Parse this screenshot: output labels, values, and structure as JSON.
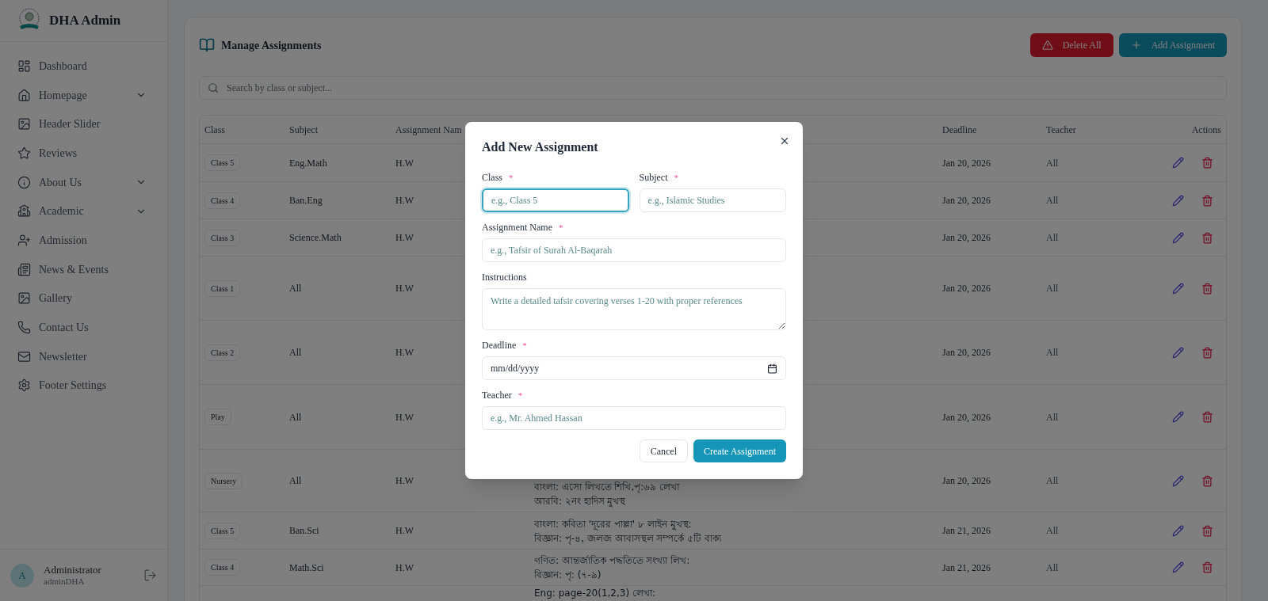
{
  "sidebar": {
    "brand": "DHA Admin",
    "items": [
      {
        "label": "Dashboard",
        "kind": "dashboard",
        "expandable": false
      },
      {
        "label": "Homepage",
        "kind": "home",
        "expandable": true
      },
      {
        "label": "Header Slider",
        "kind": "image",
        "expandable": false
      },
      {
        "label": "Reviews",
        "kind": "star",
        "expandable": false
      },
      {
        "label": "About Us",
        "kind": "info",
        "expandable": true
      },
      {
        "label": "Academic",
        "kind": "school",
        "expandable": true
      },
      {
        "label": "Admission",
        "kind": "user-plus",
        "expandable": false
      },
      {
        "label": "News & Events",
        "kind": "news",
        "expandable": false
      },
      {
        "label": "Gallery",
        "kind": "image",
        "expandable": false
      },
      {
        "label": "Contact Us",
        "kind": "phone",
        "expandable": false
      },
      {
        "label": "Newsletter",
        "kind": "mail",
        "expandable": false
      },
      {
        "label": "Footer Settings",
        "kind": "settings",
        "expandable": false
      }
    ],
    "user": {
      "initial": "A",
      "name": "Administrator",
      "username": "adminDHA"
    }
  },
  "page": {
    "title": "Manage Assignments",
    "buttons": [
      {
        "label": "Delete All",
        "kind": "danger"
      },
      {
        "label": "Add Assignment",
        "kind": "primary"
      }
    ],
    "search": {
      "placeholder": "Search by class or subject..."
    }
  },
  "table": {
    "columns": {
      "class": "Class",
      "subject": "Subject",
      "name": "Assignment Nam",
      "deadline": "Deadline",
      "teacher": "Teacher",
      "actions": "Actions"
    },
    "rows": [
      {
        "class": "Class 5",
        "subject": "Eng.Math",
        "name": "H.W",
        "deadline": "Jan 20, 2026",
        "teacher": "All"
      },
      {
        "class": "Class 4",
        "subject": "Ban.Eng",
        "name": "H.W",
        "deadline": "Jan 20, 2026",
        "teacher": "All"
      },
      {
        "class": "Class 3",
        "subject": "Science.Math",
        "name": "H.W",
        "deadline": "Jan 20, 2026",
        "teacher": "All"
      },
      {
        "class": "Class 1",
        "subject": "All",
        "name": "H.W",
        "deadline": "Jan 20, 2026",
        "teacher": "All"
      },
      {
        "class": "Class 2",
        "subject": "All",
        "name": "H.W",
        "deadline": "Jan 20, 2026",
        "teacher": "All"
      },
      {
        "class": "Play",
        "subject": "All",
        "name": "H.W",
        "deadline": "Jan 20, 2026",
        "teacher": "All"
      },
      {
        "class": "Nursery",
        "subject": "All",
        "name": "H.W",
        "instructions": [
          "বাংলা: এসো লিখতে শিখি,পৃ:৬৯ লেখা",
          "আরবি: ২নং হাদিস মুখস্থ"
        ],
        "deadline": "Jan 20, 2026",
        "teacher": "All"
      },
      {
        "class": "Class 5",
        "subject": "Ban.Sci",
        "name": "H.W",
        "instructions": [
          "বাংলা: কবিতা 'দূরের পাল্লা' ৮ লাইন মুখস্থ:",
          "বিজ্ঞান: পৃ-৪, জলজ আবাসস্থল সম্পর্কে ৫টি বাক্য"
        ],
        "deadline": "Jan 21, 2026",
        "teacher": "All"
      },
      {
        "class": "Class 4",
        "subject": "Math.Sci",
        "name": "H.W",
        "instructions": [
          "গণিত: আন্তর্জাতিক পদ্ধতিতে সংখ্যা লিখ:",
          "বিজ্ঞান: পৃ: (৭-৯)"
        ],
        "deadline": "Jan 21, 2026",
        "teacher": "All"
      },
      {
        "instructions": [
          "Eng: page-20(1,2,3) লেখা:"
        ]
      }
    ]
  },
  "modal": {
    "title": "Add New Assignment",
    "fields": [
      {
        "label": "Class",
        "required": true,
        "kind": "text",
        "placeholder": "e.g., Class 5",
        "focused": true
      },
      {
        "label": "Subject",
        "required": true,
        "kind": "text",
        "placeholder": "e.g., Islamic Studies",
        "focused": false
      },
      {
        "label": "Assignment Name",
        "required": true,
        "kind": "text",
        "placeholder": "e.g., Tafsir of Surah Al-Baqarah",
        "focused": false
      },
      {
        "label": "Instructions",
        "required": false,
        "kind": "textarea",
        "placeholder": "Write a detailed tafsir covering verses 1-20 with proper references",
        "focused": false
      },
      {
        "label": "Deadline",
        "required": true,
        "kind": "date",
        "value": "mm/dd/yyyy",
        "focused": false
      },
      {
        "label": "Teacher",
        "required": true,
        "kind": "text",
        "placeholder": "e.g., Mr. Ahmed Hassan",
        "focused": false
      }
    ],
    "required_mark": "*",
    "buttons": [
      {
        "label": "Cancel",
        "kind": "secondary"
      },
      {
        "label": "Create Assignment",
        "kind": "primary"
      }
    ]
  }
}
